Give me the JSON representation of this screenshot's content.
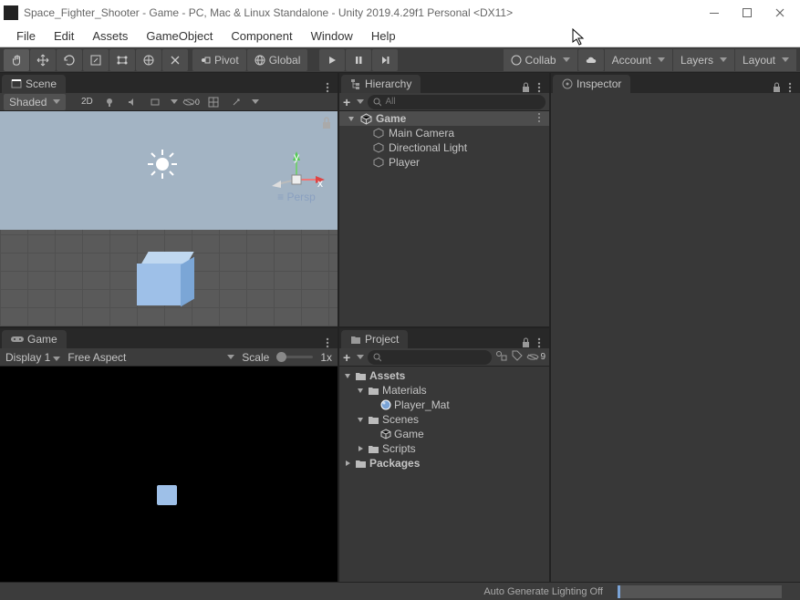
{
  "title": "Space_Fighter_Shooter - Game - PC, Mac & Linux Standalone - Unity 2019.4.29f1 Personal <DX11>",
  "menu": [
    "File",
    "Edit",
    "Assets",
    "GameObject",
    "Component",
    "Window",
    "Help"
  ],
  "toolbar": {
    "pivot": "Pivot",
    "global": "Global",
    "collab": "Collab",
    "account": "Account",
    "layers": "Layers",
    "layout": "Layout"
  },
  "tabs": {
    "scene": "Scene",
    "game": "Game",
    "hierarchy": "Hierarchy",
    "project": "Project",
    "inspector": "Inspector"
  },
  "scene": {
    "shading": "Shaded",
    "mode2d": "2D",
    "gizmo_x": "x",
    "gizmo_y": "y",
    "gizmo_persp": "Persp"
  },
  "game": {
    "display": "Display 1",
    "aspect": "Free Aspect",
    "scale_label": "Scale",
    "scale_value": "1x"
  },
  "hierarchy": {
    "search_placeholder": "All",
    "scene_name": "Game",
    "items": [
      "Main Camera",
      "Directional Light",
      "Player"
    ]
  },
  "project": {
    "assets": "Assets",
    "materials": "Materials",
    "player_mat": "Player_Mat",
    "scenes": "Scenes",
    "game_scene": "Game",
    "scripts": "Scripts",
    "packages": "Packages",
    "hidden_count": "9"
  },
  "status": "Auto Generate Lighting Off"
}
